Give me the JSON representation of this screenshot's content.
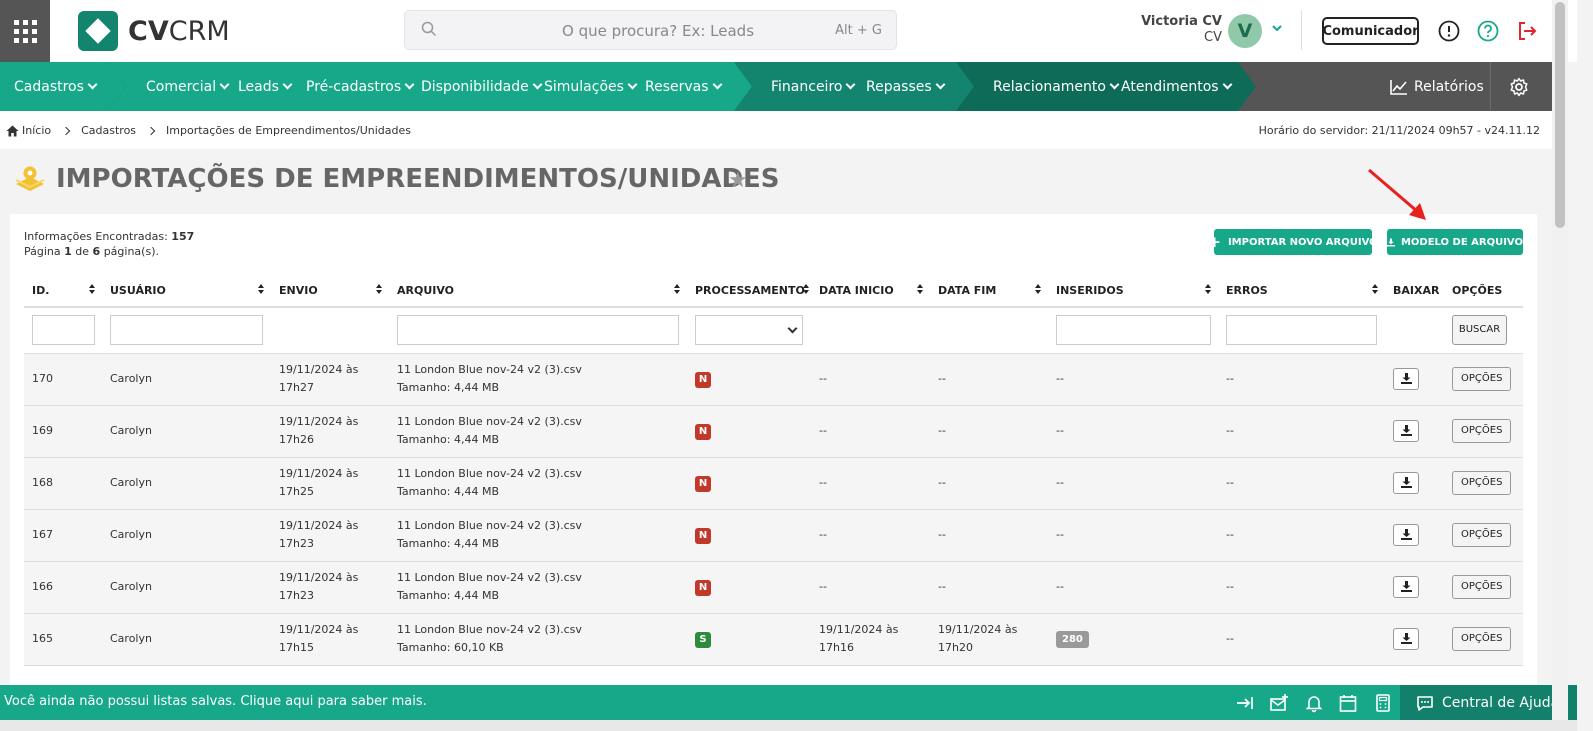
{
  "header": {
    "logo_prefix": "CV",
    "logo_suffix": "CRM",
    "search_placeholder": "O que procura? Ex: Leads",
    "search_shortcut": "Alt + G",
    "user_name": "Victoria CV",
    "user_org": "CV",
    "avatar_initial": "V",
    "comunicador_label": "Comunicador"
  },
  "nav": {
    "items": [
      "Cadastros",
      "Comercial",
      "Leads",
      "Pré-cadastros",
      "Disponibilidade",
      "Simulações",
      "Reservas",
      "Financeiro",
      "Repasses",
      "Relacionamento",
      "Atendimentos"
    ],
    "relatorios_label": "Relatórios",
    "colors": {
      "primary": "#16a889",
      "secondary": "#13856f",
      "tertiary": "#0d6b58",
      "gray": "#555555"
    }
  },
  "breadcrumb": {
    "items": [
      "Início",
      "Cadastros",
      "Importações de Empreendimentos/Unidades"
    ],
    "server_time": "Horário do servidor: 21/11/2024 09h57 - v24.11.12"
  },
  "page": {
    "title": "IMPORTAÇÕES DE EMPREENDIMENTOS/UNIDADES",
    "info_label": "Informações Encontradas:",
    "info_count": "157",
    "page_prefix": "Página",
    "page_current": "1",
    "page_of": "de",
    "page_total": "6",
    "page_suffix": "página(s).",
    "btn_import": "IMPORTAR NOVO ARQUIVO",
    "btn_model": "MODELO DE ARQUIVO"
  },
  "table": {
    "columns": [
      "ID.",
      "USUÁRIO",
      "ENVIO",
      "ARQUIVO",
      "PROCESSAMENTO",
      "DATA INICIO",
      "DATA FIM",
      "INSERIDOS",
      "ERROS",
      "BAIXAR",
      "OPÇÕES"
    ],
    "search_label": "BUSCAR",
    "options_label": "OPÇÕES",
    "rows": [
      {
        "id": "170",
        "user": "Carolyn",
        "envio_1": "19/11/2024 às",
        "envio_2": "17h27",
        "file": "11 London Blue nov-24 v2 (3).csv",
        "size": "Tamanho: 4,44 MB",
        "status": "N",
        "ini_1": "--",
        "ini_2": "",
        "fim_1": "--",
        "fim_2": "",
        "inseridos": "--",
        "erros": "--"
      },
      {
        "id": "169",
        "user": "Carolyn",
        "envio_1": "19/11/2024 às",
        "envio_2": "17h26",
        "file": "11 London Blue nov-24 v2 (3).csv",
        "size": "Tamanho: 4,44 MB",
        "status": "N",
        "ini_1": "--",
        "ini_2": "",
        "fim_1": "--",
        "fim_2": "",
        "inseridos": "--",
        "erros": "--"
      },
      {
        "id": "168",
        "user": "Carolyn",
        "envio_1": "19/11/2024 às",
        "envio_2": "17h25",
        "file": "11 London Blue nov-24 v2 (3).csv",
        "size": "Tamanho: 4,44 MB",
        "status": "N",
        "ini_1": "--",
        "ini_2": "",
        "fim_1": "--",
        "fim_2": "",
        "inseridos": "--",
        "erros": "--"
      },
      {
        "id": "167",
        "user": "Carolyn",
        "envio_1": "19/11/2024 às",
        "envio_2": "17h23",
        "file": "11 London Blue nov-24 v2 (3).csv",
        "size": "Tamanho: 4,44 MB",
        "status": "N",
        "ini_1": "--",
        "ini_2": "",
        "fim_1": "--",
        "fim_2": "",
        "inseridos": "--",
        "erros": "--"
      },
      {
        "id": "166",
        "user": "Carolyn",
        "envio_1": "19/11/2024 às",
        "envio_2": "17h23",
        "file": "11 London Blue nov-24 v2 (3).csv",
        "size": "Tamanho: 4,44 MB",
        "status": "N",
        "ini_1": "--",
        "ini_2": "",
        "fim_1": "--",
        "fim_2": "",
        "inseridos": "--",
        "erros": "--"
      },
      {
        "id": "165",
        "user": "Carolyn",
        "envio_1": "19/11/2024 às",
        "envio_2": "17h15",
        "file": "11 London Blue nov-24 v2 (3).csv",
        "size": "Tamanho: 60,10 KB",
        "status": "S",
        "ini_1": "19/11/2024 às",
        "ini_2": "17h16",
        "fim_1": "19/11/2024 às",
        "fim_2": "17h20",
        "inseridos": "280",
        "erros": "--"
      }
    ]
  },
  "footer": {
    "message": "Você ainda não possui listas salvas. Clique aqui para saber mais.",
    "help_label": "Central de Ajuda"
  }
}
